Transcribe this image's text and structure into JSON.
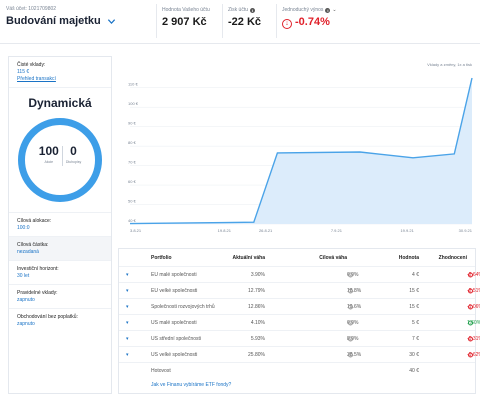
{
  "header": {
    "account_label": "Váš účet: 1021709802",
    "account_name": "Budování majetku",
    "metrics": [
      {
        "label": "Hodnota Vašeho účtu",
        "value": "2 907 Kč"
      },
      {
        "label": "Zisk účtu",
        "value": "-22 Kč"
      },
      {
        "label": "Jednoduchý výnos",
        "value": "-0.74%"
      }
    ]
  },
  "sidebar": {
    "net_deposits_label": "Čisté vklady:",
    "net_deposits_value": "115 €",
    "transactions_link": "Přehled transakcí",
    "strategy_title": "Dynamická",
    "stocks_pct": "100",
    "stocks_caption": "Akcie",
    "bonds_pct": "0",
    "bonds_caption": "Dluhopisy",
    "target_allocation_label": "Cílová alokace:",
    "target_allocation_value": "100:0",
    "target_amount_label": "Cílová částka:",
    "target_amount_value": "nezadaná",
    "horizon_label": "Investiční horizont:",
    "horizon_value": "30 let",
    "regular_deposits_label": "Pravidelné vklady:",
    "regular_deposits_value": "zapnuto",
    "fee_free_label": "Obchodování bez poplatků:",
    "fee_free_value": "zapnuto"
  },
  "chart_data": {
    "type": "area",
    "legend_note": "Vklady a změny, 1x a tisk",
    "y_ticks": [
      "110 €",
      "100 €",
      "90 €",
      "80 €",
      "70 €",
      "60 €",
      "50 €",
      "40 €"
    ],
    "x_ticks": [
      "3.8.21",
      "19.8.21",
      "26.8.21",
      "7.9.21",
      "19.9.21",
      "30.9.21"
    ],
    "ylim": [
      40,
      115
    ],
    "points": [
      {
        "x": "3.8.21",
        "y": 40.2
      },
      {
        "x": "19.8.21",
        "y": 40.7
      },
      {
        "x": "24.8.21",
        "y": 40.9
      },
      {
        "x": "28.8.21",
        "y": 76.5
      },
      {
        "x": "11.9.21",
        "y": 77.0
      },
      {
        "x": "20.9.21",
        "y": 74.0
      },
      {
        "x": "27.9.21",
        "y": 76.0
      },
      {
        "x": "30.9.21",
        "y": 115.0
      }
    ],
    "line_color": "#4aa3e8",
    "fill_color": "#dcecfb"
  },
  "table": {
    "headers": {
      "portfolio": "Portfolio",
      "current": "Aktuální váha",
      "target": "Cílová váha",
      "value": "Hodnota",
      "gain": "Zhodnocení"
    },
    "rows": [
      {
        "name": "EU malé společnosti",
        "current": "3.90%",
        "target": "6.0%",
        "value": "4 €",
        "gain": "-2.64%",
        "dir": "neg"
      },
      {
        "name": "EU velké společnosti",
        "current": "12.79%",
        "target": "18.8%",
        "value": "15 €",
        "gain": "-2.51%",
        "dir": "neg"
      },
      {
        "name": "Společnosti rozvojových trhů",
        "current": "12.86%",
        "target": "19.6%",
        "value": "15 €",
        "gain": "-1.06%",
        "dir": "neg"
      },
      {
        "name": "US malé společnosti",
        "current": "4.10%",
        "target": "6.0%",
        "value": "5 €",
        "gain": "1.60%",
        "dir": "pos"
      },
      {
        "name": "US střední společnosti",
        "current": "5.93%",
        "target": "8.0%",
        "value": "7 €",
        "gain": "-0.31%",
        "dir": "neg"
      },
      {
        "name": "US velké společnosti",
        "current": "25.80%",
        "target": "38.5%",
        "value": "30 €",
        "gain": "-0.62%",
        "dir": "neg"
      }
    ],
    "cash_label": "Hotovost",
    "cash_value": "40 €",
    "faq_link": "Jak ve Finanu vybíráme ETF fondy?"
  }
}
